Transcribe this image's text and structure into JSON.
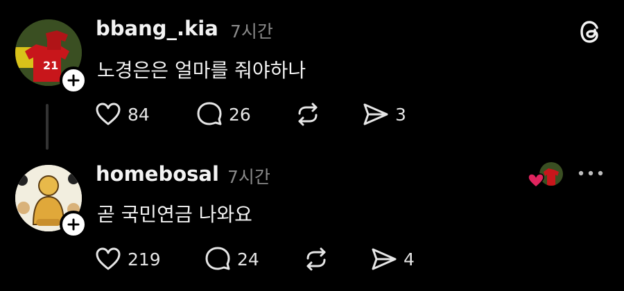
{
  "posts": [
    {
      "username": "bbang_.kia",
      "time": "7시간",
      "text": "노경은은 얼마를 줘야하나",
      "likes": "84",
      "replies": "26",
      "shares": "3"
    },
    {
      "username": "homebosal",
      "time": "7시간",
      "text": "곧 국민연금 나와요",
      "likes": "219",
      "replies": "24",
      "shares": "4"
    }
  ],
  "colors": {
    "background": "#000000",
    "muted": "#8a8a8a",
    "heart": "#e0245e"
  }
}
